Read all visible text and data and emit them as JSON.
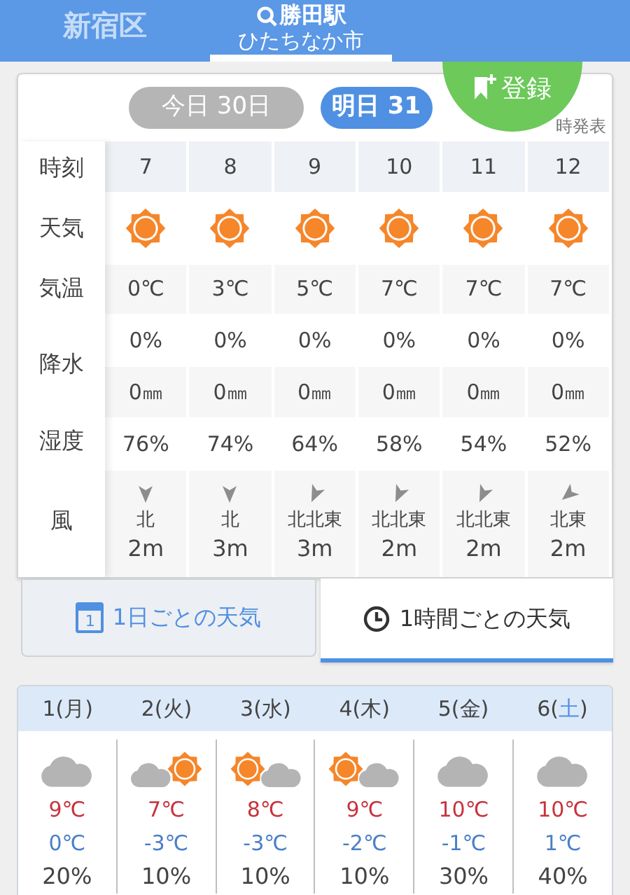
{
  "header": {
    "tabs": [
      {
        "label": "新宿区",
        "selected": false
      },
      {
        "label": "勝田駅",
        "sublabel": "ひたちなか市",
        "selected": true
      }
    ]
  },
  "register_button": {
    "label": "登録"
  },
  "day_tabs": [
    {
      "label": "今日 30日",
      "selected": false
    },
    {
      "label": "明日 31",
      "selected": true
    }
  ],
  "issued": "時発表",
  "hourly": {
    "row_labels": {
      "time": "時刻",
      "weather": "天気",
      "temp": "気温",
      "rain": "降水",
      "humidity": "湿度",
      "wind": "風"
    },
    "hours": [
      {
        "time": "7",
        "weather_icon": {
          "kind": "sunny"
        },
        "temp": "0℃",
        "rain_chance": "0%",
        "rain_amount": "0㎜",
        "humidity": "76%",
        "wind_arrow": {
          "kind": "n"
        },
        "wind_direction": "北",
        "wind_speed": "2m"
      },
      {
        "time": "8",
        "weather_icon": {
          "kind": "sunny"
        },
        "temp": "3℃",
        "rain_chance": "0%",
        "rain_amount": "0㎜",
        "humidity": "74%",
        "wind_arrow": {
          "kind": "n"
        },
        "wind_direction": "北",
        "wind_speed": "3m"
      },
      {
        "time": "9",
        "weather_icon": {
          "kind": "sunny"
        },
        "temp": "5℃",
        "rain_chance": "0%",
        "rain_amount": "0㎜",
        "humidity": "64%",
        "wind_arrow": {
          "kind": "nne"
        },
        "wind_direction": "北北東",
        "wind_speed": "3m"
      },
      {
        "time": "10",
        "weather_icon": {
          "kind": "sunny"
        },
        "temp": "7℃",
        "rain_chance": "0%",
        "rain_amount": "0㎜",
        "humidity": "58%",
        "wind_arrow": {
          "kind": "nne"
        },
        "wind_direction": "北北東",
        "wind_speed": "2m"
      },
      {
        "time": "11",
        "weather_icon": {
          "kind": "sunny"
        },
        "temp": "7℃",
        "rain_chance": "0%",
        "rain_amount": "0㎜",
        "humidity": "54%",
        "wind_arrow": {
          "kind": "nne"
        },
        "wind_direction": "北北東",
        "wind_speed": "2m"
      },
      {
        "time": "12",
        "weather_icon": {
          "kind": "sunny"
        },
        "temp": "7℃",
        "rain_chance": "0%",
        "rain_amount": "0㎜",
        "humidity": "52%",
        "wind_arrow": {
          "kind": "ne"
        },
        "wind_direction": "北東",
        "wind_speed": "2m"
      }
    ]
  },
  "view_tabs": [
    {
      "label": "1日ごとの天気",
      "icon": {
        "kind": "calendar",
        "label": "1"
      },
      "selected": false
    },
    {
      "label": "1時間ごとの天気",
      "icon": {
        "kind": "clock"
      },
      "selected": true
    }
  ],
  "weekly": [
    {
      "day": "1(",
      "weekday": "月",
      "close": ")",
      "saturday": false,
      "icon": {
        "kind": "cloudy"
      },
      "high": "9℃",
      "low": "0℃",
      "rain": "20%"
    },
    {
      "day": "2(",
      "weekday": "火",
      "close": ")",
      "saturday": false,
      "icon": {
        "kind": "cloudy_sunny"
      },
      "high": "7℃",
      "low": "-3℃",
      "rain": "10%"
    },
    {
      "day": "3(",
      "weekday": "水",
      "close": ")",
      "saturday": false,
      "icon": {
        "kind": "sunny_cloudy"
      },
      "high": "8℃",
      "low": "-3℃",
      "rain": "10%"
    },
    {
      "day": "4(",
      "weekday": "木",
      "close": ")",
      "saturday": false,
      "icon": {
        "kind": "sunny_cloudy"
      },
      "high": "9℃",
      "low": "-2℃",
      "rain": "10%"
    },
    {
      "day": "5(",
      "weekday": "金",
      "close": ")",
      "saturday": false,
      "icon": {
        "kind": "cloudy"
      },
      "high": "10℃",
      "low": "-1℃",
      "rain": "30%"
    },
    {
      "day": "6(",
      "weekday": "土",
      "close": ")",
      "saturday": true,
      "icon": {
        "kind": "cloudy"
      },
      "high": "10℃",
      "low": "1℃",
      "rain": "40%"
    }
  ]
}
